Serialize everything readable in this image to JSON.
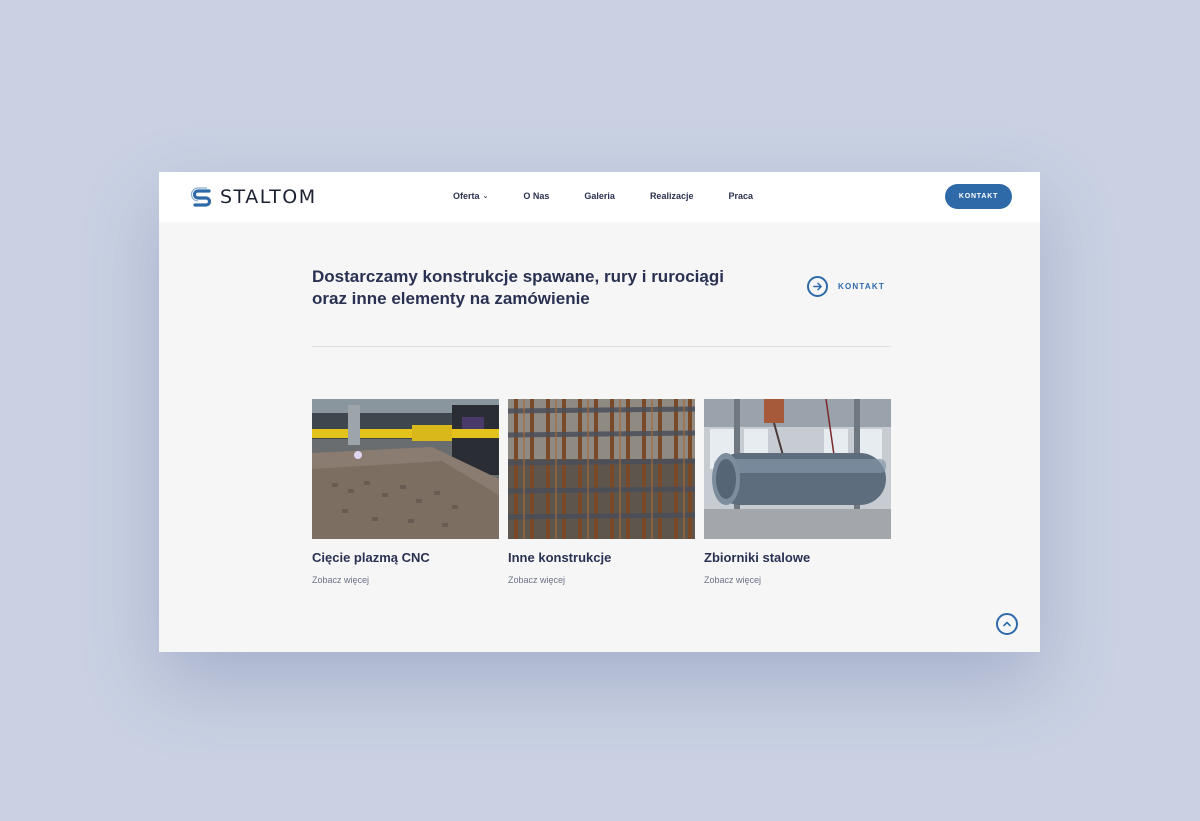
{
  "brand": {
    "name": "STALTOM",
    "accent": "#2f6aa8",
    "dark": "#2a3152"
  },
  "nav": {
    "items": [
      {
        "label": "Oferta",
        "has_dropdown": true
      },
      {
        "label": "O Nas"
      },
      {
        "label": "Galeria"
      },
      {
        "label": "Realizacje"
      },
      {
        "label": "Praca"
      }
    ],
    "contact_button": "KONTAKT"
  },
  "hero": {
    "title": "Dostarczamy konstrukcje spawane, rury i rurociągi oraz inne elementy na zamówienie",
    "link_label": "KONTAKT",
    "link_icon": "arrow-right-circle-icon"
  },
  "cards": [
    {
      "title": "Cięcie plazmą CNC",
      "more": "Zobacz więcej",
      "image": "cnc-plasma-cutting-photo"
    },
    {
      "title": "Inne konstrukcje",
      "more": "Zobacz więcej",
      "image": "rebar-cage-photo"
    },
    {
      "title": "Zbiorniki stalowe",
      "more": "Zobacz więcej",
      "image": "steel-tank-photo"
    }
  ],
  "scroll_top_icon": "chevron-up-circle-icon"
}
